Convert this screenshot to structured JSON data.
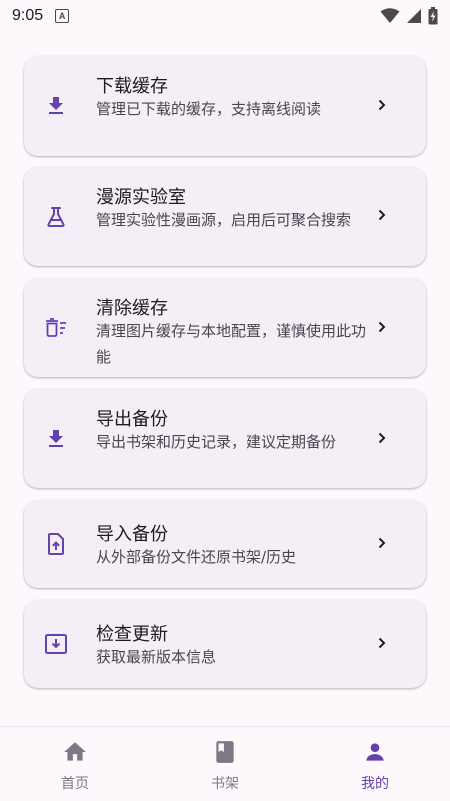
{
  "status_bar": {
    "time": "9:05",
    "notification_letter": "A"
  },
  "menu": [
    {
      "title": "下载缓存",
      "desc": "管理已下载的缓存，支持离线阅读",
      "icon": "download-icon"
    },
    {
      "title": "漫源实验室",
      "desc": "管理实验性漫画源，启用后可聚合搜索",
      "icon": "flask-icon"
    },
    {
      "title": "清除缓存",
      "desc": "清理图片缓存与本地配置，谨慎使用此功能",
      "icon": "delete-sweep-icon"
    },
    {
      "title": "导出备份",
      "desc": "导出书架和历史记录，建议定期备份",
      "icon": "download-icon"
    },
    {
      "title": "导入备份",
      "desc": "从外部备份文件还原书架/历史",
      "icon": "file-upload-icon"
    },
    {
      "title": "检查更新",
      "desc": "获取最新版本信息",
      "icon": "system-update-icon"
    }
  ],
  "bottom_nav": [
    {
      "label": "首页",
      "icon": "home-icon",
      "active": false
    },
    {
      "label": "书架",
      "icon": "book-icon",
      "active": false
    },
    {
      "label": "我的",
      "icon": "person-icon",
      "active": true
    }
  ],
  "colors": {
    "accent": "#6442ad",
    "card": "#f4eef6",
    "background": "#fdf8fc",
    "nav_inactive": "#7d7885"
  }
}
